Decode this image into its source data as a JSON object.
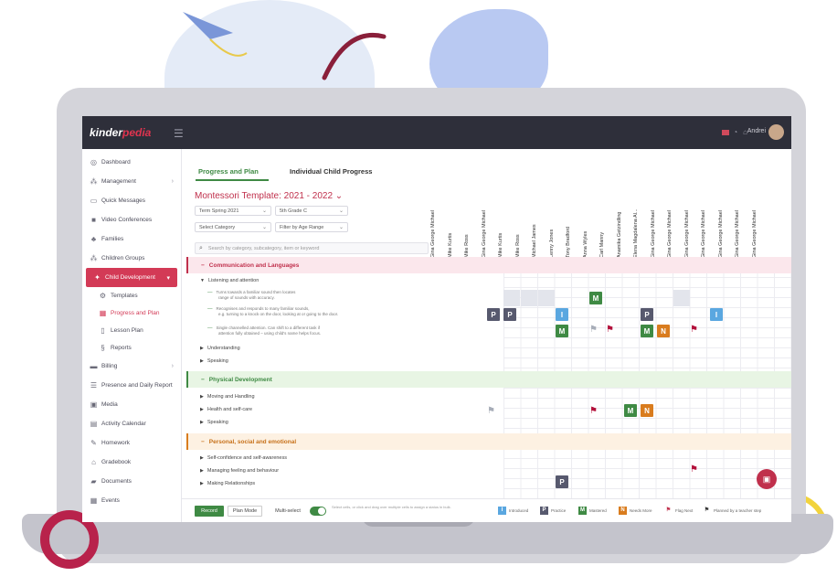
{
  "app": {
    "logo_a": "kinder",
    "logo_b": "pedia",
    "user_name": "Andrei"
  },
  "sidebar": {
    "items": [
      {
        "label": "Dashboard",
        "icon": "dashboard-icon"
      },
      {
        "label": "Management",
        "icon": "management-icon"
      },
      {
        "label": "Quick Messages",
        "icon": "message-icon"
      },
      {
        "label": "Video Conferences",
        "icon": "video-icon"
      },
      {
        "label": "Families",
        "icon": "families-icon"
      },
      {
        "label": "Children Groups",
        "icon": "groups-icon"
      },
      {
        "label": "Child Development",
        "icon": "development-icon"
      },
      {
        "label": "Templates",
        "icon": "templates-icon"
      },
      {
        "label": "Progress and Plan",
        "icon": "progress-icon"
      },
      {
        "label": "Lesson Plan",
        "icon": "lesson-icon"
      },
      {
        "label": "Reports",
        "icon": "reports-icon"
      },
      {
        "label": "Billing",
        "icon": "billing-icon"
      },
      {
        "label": "Presence and Daily Report",
        "icon": "presence-icon"
      },
      {
        "label": "Media",
        "icon": "media-icon"
      },
      {
        "label": "Activity Calendar",
        "icon": "calendar-icon"
      },
      {
        "label": "Homework",
        "icon": "homework-icon"
      },
      {
        "label": "Gradebook",
        "icon": "gradebook-icon"
      },
      {
        "label": "Documents",
        "icon": "documents-icon"
      },
      {
        "label": "Events",
        "icon": "events-icon"
      }
    ]
  },
  "tabs": {
    "progress": "Progress and Plan",
    "individual": "Individual Child Progress"
  },
  "template_title": "Montessori Template: 2021 - 2022",
  "filters": {
    "term": "Term Spring 2021",
    "group": "5th Grade C",
    "category": "Select Category",
    "age": "Filter by Age Range"
  },
  "search": {
    "placeholder": "Search by category, subcategory, item or keyword"
  },
  "categories": [
    {
      "label": "Communication and Languages",
      "color": "#fbe7ec",
      "text": "#c0304c"
    },
    {
      "label": "Physical Development",
      "color": "#e8f5e4",
      "text": "#3f8a44"
    },
    {
      "label": "Personal, social and emotional",
      "color": "#fdf1e2",
      "text": "#c7711a"
    }
  ],
  "rows": {
    "listening": "Listening and attention",
    "items": [
      {
        "text": "Turns towards a familiar sound then locates",
        "text2": "range of sounds with accuracy."
      },
      {
        "text": "Recognises and responds to many familiar sounds,",
        "text2": "e.g. turning to a knock on the door, looking at or going to the door."
      },
      {
        "text": "Single channelled attention. Can shift to a different task if",
        "text2": "attention fully obtained – using child's name helps focus."
      }
    ],
    "understanding": "Understanding",
    "speaking": "Speaking",
    "moving": "Moving and Handling",
    "health": "Health and self-care",
    "speaking2": "Speaking",
    "self_conf": "Self-confidence and self-awareness",
    "managing": "Managing feeling and behaviour",
    "making": "Making Relationships"
  },
  "children": [
    "Gina George Michael",
    "Mike Kurtis",
    "Mike Ross",
    "Gina George Michael",
    "Mike Kurtis",
    "Mike Ross",
    "Michael James",
    "Lenny Jones",
    "Tony Bradford",
    "Anna Wyles",
    "Carl Manny",
    "Anamika Getzindling",
    "Elena Magdalena Al...",
    "Gina George Michael",
    "Gina George Michael",
    "Gina George Michael",
    "Gina George Michael",
    "Gina George Michael",
    "Gina George Michael",
    "Gina George Michael"
  ],
  "badges": {
    "P": "P",
    "M": "M",
    "N": "N",
    "I": "I"
  },
  "bottom": {
    "record": "Record",
    "plan": "Plan Mode",
    "multi": "Multi-select",
    "hint": "Select cells, or click and drag over multiple cells to assign a status in bulk."
  },
  "legend": [
    {
      "sym": "I",
      "label": "Introduced",
      "color": "#5aa7e0"
    },
    {
      "sym": "P",
      "label": "Practice",
      "color": "#57596e"
    },
    {
      "sym": "M",
      "label": "Mastered",
      "color": "#3f8a44"
    },
    {
      "sym": "N",
      "label": "Needs More",
      "color": "#d97c1e"
    },
    {
      "sym": "⚑",
      "label": "Flag Next",
      "color": "#c0304c"
    },
    {
      "sym": "⚑",
      "label": "Planned by a teacher step",
      "color": "#333333"
    }
  ],
  "colors": {
    "accent": "#c0304c",
    "green": "#3f8a44",
    "topbar": "#2e2f3a"
  }
}
